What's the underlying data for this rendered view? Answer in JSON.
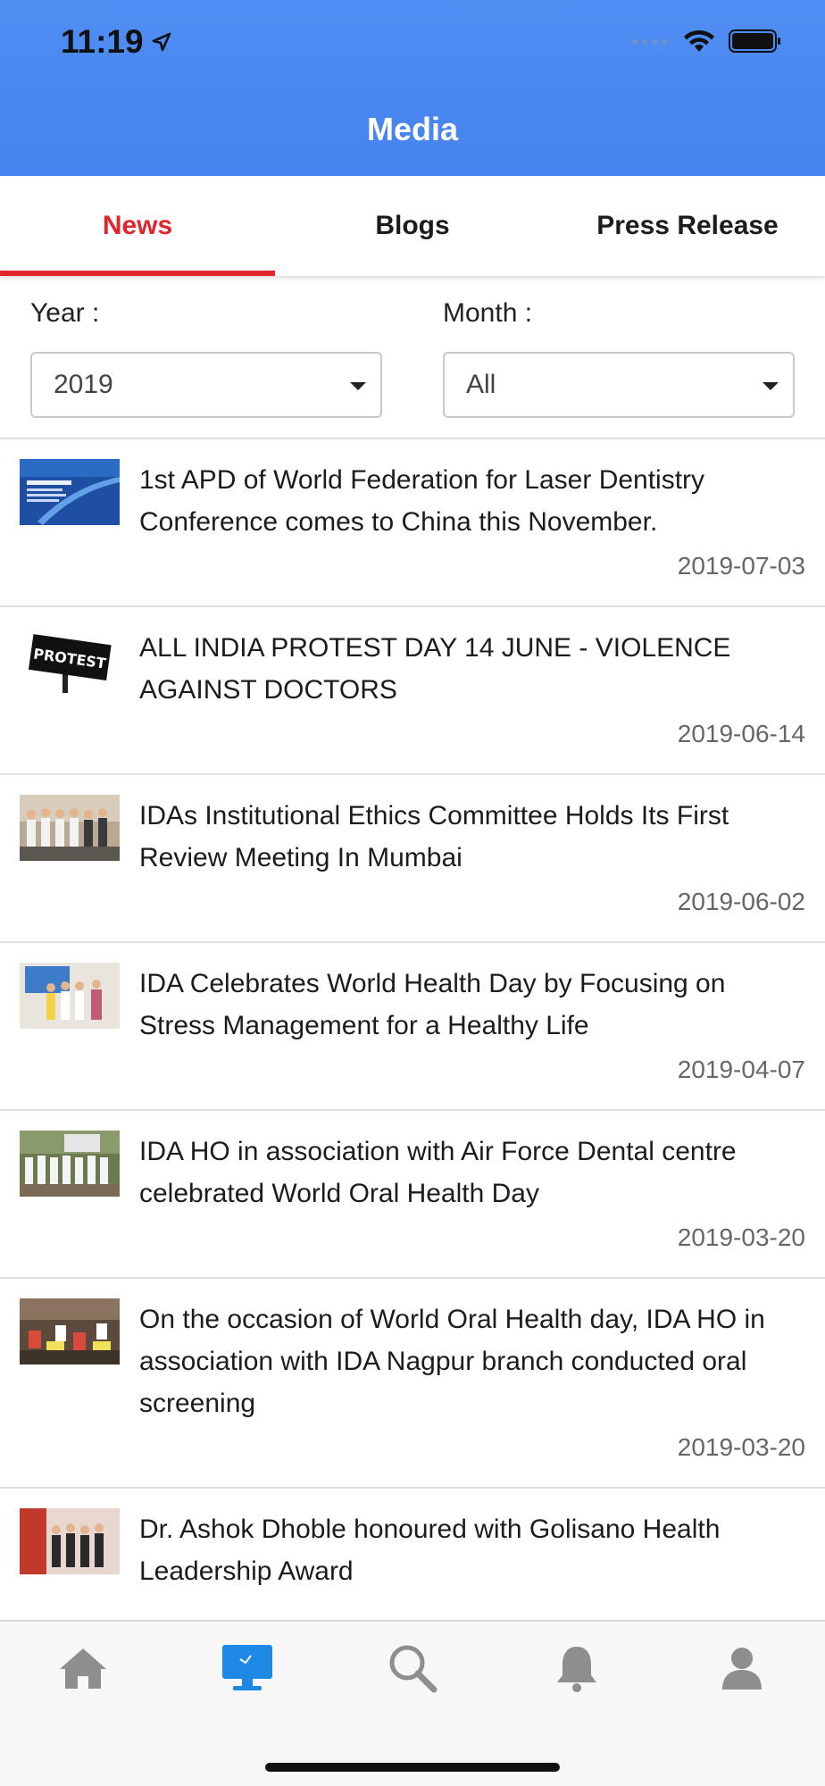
{
  "status": {
    "time": "11:19"
  },
  "header": {
    "title": "Media"
  },
  "tabs": [
    {
      "label": "News",
      "active": true
    },
    {
      "label": "Blogs",
      "active": false
    },
    {
      "label": "Press Release",
      "active": false
    }
  ],
  "filters": {
    "year": {
      "label": "Year :",
      "value": "2019"
    },
    "month": {
      "label": "Month :",
      "value": "All"
    }
  },
  "news": [
    {
      "title": "1st APD of World Federation for Laser Dentistry Conference comes to China this November.",
      "date": "2019-07-03"
    },
    {
      "title": "ALL INDIA PROTEST DAY 14 JUNE - VIOLENCE AGAINST DOCTORS",
      "date": "2019-06-14",
      "thumb_text": "PROTEST"
    },
    {
      "title": "IDAs Institutional Ethics Committee Holds Its First Review Meeting In Mumbai",
      "date": "2019-06-02"
    },
    {
      "title": "IDA Celebrates World Health Day by Focusing on Stress Management for a Healthy Life",
      "date": "2019-04-07"
    },
    {
      "title": "IDA HO in association with Air Force Dental centre celebrated World Oral Health Day",
      "date": "2019-03-20"
    },
    {
      "title": "On the occasion of World Oral Health day, IDA HO in association with IDA Nagpur branch conducted oral screening",
      "date": "2019-03-20"
    },
    {
      "title": "Dr. Ashok Dhoble honoured with Golisano Health Leadership Award",
      "date": ""
    }
  ],
  "tabbar": {
    "items": [
      {
        "icon": "home-icon",
        "active": false
      },
      {
        "icon": "media-monitor-icon",
        "active": true
      },
      {
        "icon": "search-icon",
        "active": false
      },
      {
        "icon": "bell-icon",
        "active": false
      },
      {
        "icon": "profile-icon",
        "active": false
      }
    ]
  },
  "colors": {
    "header": "#4a87f0",
    "accent": "#e0262c",
    "tabbar_active": "#1e88e5",
    "tabbar_inactive": "#8e8e8e"
  }
}
